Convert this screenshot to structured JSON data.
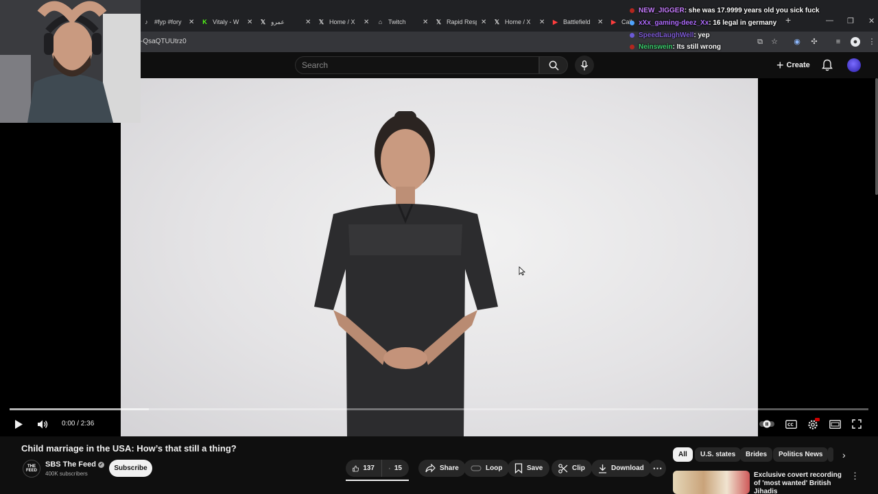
{
  "browser": {
    "tabs": [
      {
        "label": "#fyp #fory",
        "icon": "tiktok-icon"
      },
      {
        "label": "Vitaly - W",
        "icon": "kick-icon"
      },
      {
        "label": "عمرو",
        "icon": "x-icon"
      },
      {
        "label": "Home / X",
        "icon": "x-icon"
      },
      {
        "label": "Twitch",
        "icon": "gamepad-icon"
      },
      {
        "label": "Rapid Resp",
        "icon": "x-icon"
      },
      {
        "label": "Home / X",
        "icon": "x-icon"
      },
      {
        "label": "Battlefield",
        "icon": "youtube-icon"
      },
      {
        "label": "Call",
        "icon": "youtube-icon"
      }
    ],
    "url": "-QsaQTUUtrz0"
  },
  "youtube": {
    "search_placeholder": "Search",
    "create_label": "Create"
  },
  "chat": [
    {
      "user": "NEW_JIGGER",
      "message": ": she was 17.9999 years old you sick fuck",
      "color": "#c77dff"
    },
    {
      "user": "xXx_gaming-deez_Xx",
      "message": ": 16 legal in germany",
      "color": "#b06cff"
    },
    {
      "user": "SpeedLaughWell",
      "message": ": yep",
      "color": "#7f5bd6"
    },
    {
      "user": "Neinswein",
      "message": ": Its still wrong",
      "color": "#3ccf6e"
    }
  ],
  "player": {
    "time": "0:00 / 2:36",
    "progress_loaded": 0.162
  },
  "video": {
    "title": "Child marriage in the USA: How’s that still a thing?",
    "channel": "SBS The Feed",
    "channel_logo_text": "THE FEED",
    "subscribers": "400K subscribers",
    "subscribe_label": "Subscribe",
    "likes": "137",
    "dislikes": "15",
    "share_label": "Share",
    "loop_label": "Loop",
    "save_label": "Save",
    "clip_label": "Clip",
    "download_label": "Download"
  },
  "chips": [
    {
      "label": "All",
      "active": true
    },
    {
      "label": "U.S. states",
      "active": false
    },
    {
      "label": "Brides",
      "active": false
    },
    {
      "label": "Politics News",
      "active": false
    }
  ],
  "recommendation": {
    "title": "Exclusive covert recording of 'most wanted' British Jihadis"
  },
  "colors": {
    "background": "#0f0f0f",
    "chrome": "#202124",
    "address_bar": "#35363a",
    "pill": "#272727"
  }
}
